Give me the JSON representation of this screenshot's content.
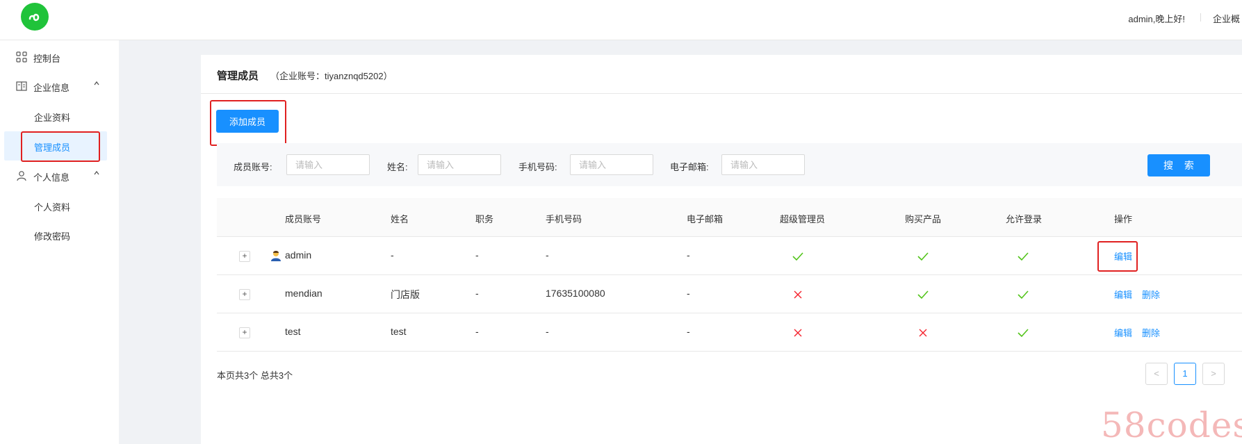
{
  "header": {
    "greeting": "admin,晚上好!",
    "nav_item": "企业概"
  },
  "sidebar": {
    "items": [
      {
        "label": "控制台",
        "icon": "dashboard-icon"
      },
      {
        "label": "企业信息",
        "icon": "building-icon",
        "chevron": "^"
      },
      {
        "label": "企业资料"
      },
      {
        "label": "管理成员",
        "active": true
      },
      {
        "label": "个人信息",
        "icon": "user-icon",
        "chevron": "^"
      },
      {
        "label": "个人资料"
      },
      {
        "label": "修改密码"
      }
    ]
  },
  "panel": {
    "title": "管理成员",
    "subtitle": "（企业账号：tiyanznqd5202）",
    "add_button": "添加成员"
  },
  "filters": {
    "account_label": "成员账号:",
    "name_label": "姓名:",
    "phone_label": "手机号码:",
    "email_label": "电子邮箱:",
    "placeholder": "请输入",
    "search_button": "搜 索"
  },
  "table": {
    "columns": [
      "成员账号",
      "姓名",
      "职务",
      "手机号码",
      "电子邮箱",
      "超级管理员",
      "购买产品",
      "允许登录",
      "操作"
    ],
    "rows": [
      {
        "account": "admin",
        "name": "-",
        "title": "-",
        "phone": "-",
        "email": "-",
        "super_admin": true,
        "buy_product": true,
        "allow_login": true,
        "edit": "编辑",
        "delete": ""
      },
      {
        "account": "mendian",
        "name": "门店版",
        "title": "-",
        "phone": "17635100080",
        "email": "-",
        "super_admin": false,
        "buy_product": true,
        "allow_login": true,
        "edit": "编辑",
        "delete": "删除"
      },
      {
        "account": "test",
        "name": "test",
        "title": "-",
        "phone": "-",
        "email": "-",
        "super_admin": false,
        "buy_product": false,
        "allow_login": true,
        "edit": "编辑",
        "delete": "删除"
      }
    ],
    "expand_symbol": "+"
  },
  "pagination": {
    "summary": "本页共3个 总共3个",
    "prev": "<",
    "current": "1",
    "next": ">"
  },
  "watermark": "58codes",
  "colors": {
    "primary": "#1890ff",
    "check": "#52c41a",
    "cross": "#f5222d",
    "highlight": "#e02020"
  }
}
